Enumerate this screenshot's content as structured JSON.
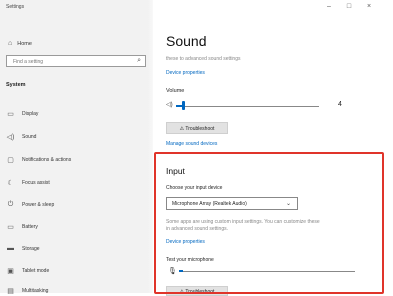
{
  "window": {
    "title": "Settings",
    "controls": [
      "–",
      "□",
      "×"
    ]
  },
  "sidebar": {
    "home_label": "Home",
    "search_placeholder": "Find a setting",
    "section_label": "System",
    "items": [
      {
        "label": "Display",
        "icon": "monitor-icon"
      },
      {
        "label": "Sound",
        "icon": "speaker-icon"
      },
      {
        "label": "Notifications & actions",
        "icon": "notification-icon"
      },
      {
        "label": "Focus assist",
        "icon": "moon-icon"
      },
      {
        "label": "Power & sleep",
        "icon": "power-icon"
      },
      {
        "label": "Battery",
        "icon": "battery-icon"
      },
      {
        "label": "Storage",
        "icon": "storage-icon"
      },
      {
        "label": "Tablet mode",
        "icon": "tablet-icon"
      },
      {
        "label": "Multitasking",
        "icon": "multitask-icon"
      }
    ]
  },
  "main": {
    "title": "Sound",
    "intro_text": "these to advanced sound settings",
    "device_properties_top": "Device properties",
    "volume_label": "Volume",
    "volume_value": "4",
    "volume_level": 0.04,
    "troubleshoot_label": "Troubleshoot",
    "manage_devices_link": "Manage sound devices",
    "input": {
      "title": "Input",
      "choose_label": "Choose your input device",
      "selected_device": "Microphone Array (Realtek Audio)",
      "note_line1": "Some apps are using custom input settings. You can customize these",
      "note_line2": "in advanced sound settings.",
      "device_properties": "Device properties",
      "test_label": "Test your microphone",
      "mic_level": 0.02,
      "troubleshoot_label": "Troubleshoot"
    }
  }
}
